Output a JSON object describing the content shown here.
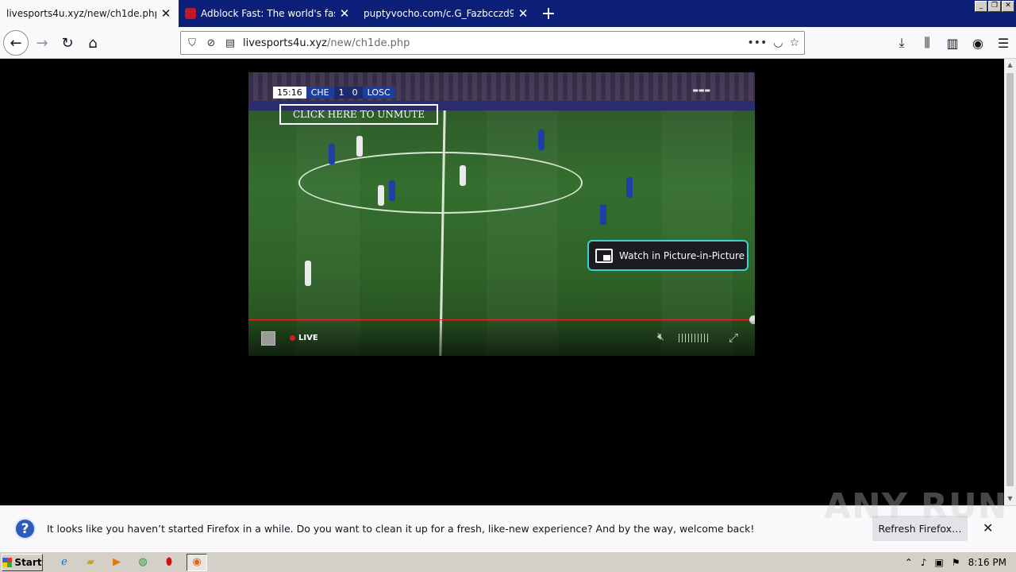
{
  "browser": {
    "tabs": [
      {
        "title": "livesports4u.xyz/new/ch1de.php",
        "active": true
      },
      {
        "title": "Adblock Fast: The world's fastest",
        "active": false
      },
      {
        "title": "puptyvocho.com/c.G_Fazbcczd9-kfag",
        "active": false
      }
    ],
    "new_tab_label": "+",
    "window_controls": {
      "minimize": "_",
      "maximize": "❐",
      "close": "✕"
    },
    "url_host": "livesports4u.xyz",
    "url_path": "/new/ch1de.php"
  },
  "player": {
    "scorebug": {
      "clock": "15:16",
      "home": "CHE",
      "home_score": "1",
      "away_score": "0",
      "away": "LOSC"
    },
    "unmute_label": "CLICK HERE TO UNMUTE",
    "pip_label": "Watch in Picture-in-Picture",
    "live_label": "LIVE",
    "progress": 1.0
  },
  "notification": {
    "message": "It looks like you haven’t started Firefox in a while. Do you want to clean it up for a fresh, like-new experience? And by the way, welcome back!",
    "button_label": "Refresh Firefox…",
    "icon": "question-icon"
  },
  "watermark": "ANY RUN",
  "taskbar": {
    "start_label": "Start",
    "time": "8:16 PM"
  },
  "colors": {
    "tab_strip": "#0b1e78",
    "pip_border": "#39d6c8",
    "live_dot": "#e0191e",
    "progress": "#ee2222"
  }
}
